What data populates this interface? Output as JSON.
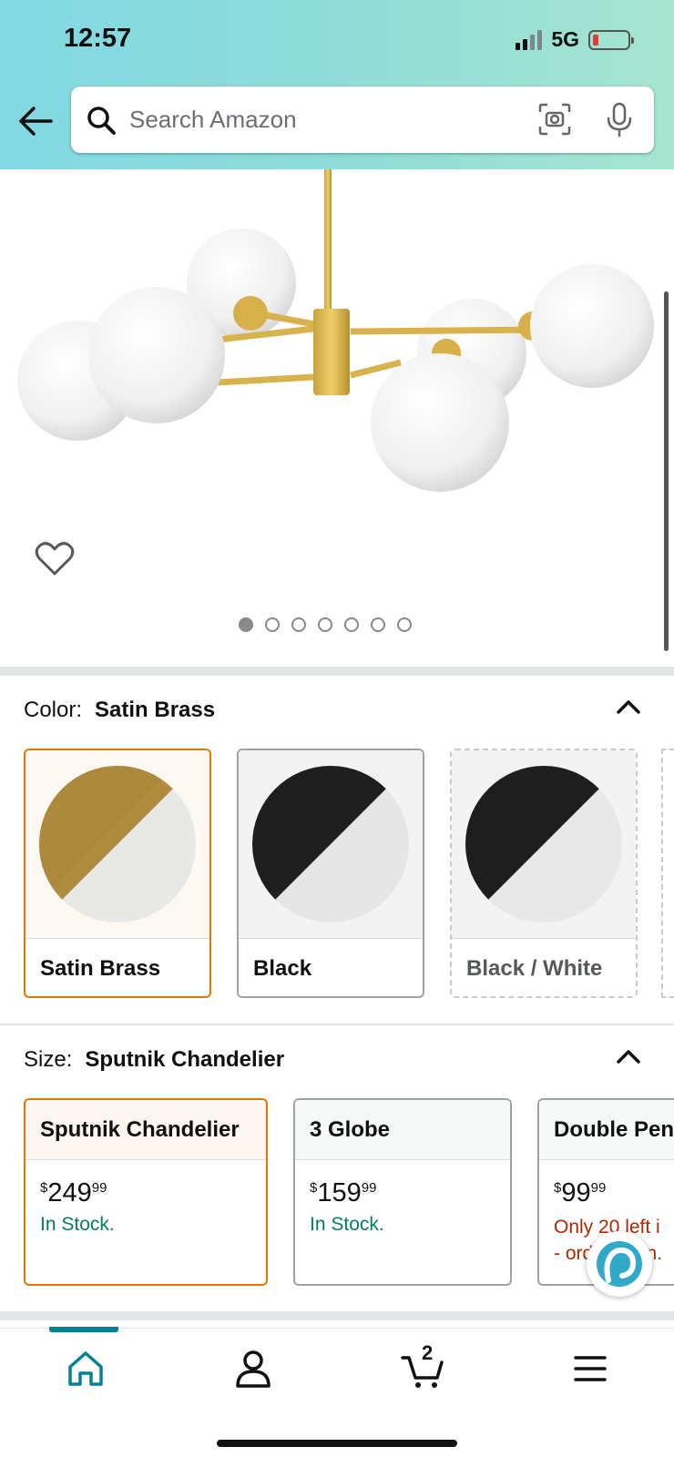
{
  "status_bar": {
    "time": "12:57",
    "network": "5G"
  },
  "search": {
    "placeholder": "Search Amazon"
  },
  "gallery": {
    "image_count": 7,
    "active_index": 0
  },
  "color": {
    "label": "Color:",
    "selected": "Satin Brass",
    "options": [
      {
        "name": "Satin Brass",
        "top_color": "#b08d3e",
        "state": "selected"
      },
      {
        "name": "Black",
        "top_color": "#1e1e1e",
        "state": "available"
      },
      {
        "name": "Black / White",
        "top_color": "#1e1e1e",
        "state": "unavailable"
      }
    ]
  },
  "size": {
    "label": "Size:",
    "selected": "Sputnik Chandelier",
    "options": [
      {
        "name": "Sputnik Chandelier",
        "currency": "$",
        "dollars": "249",
        "cents": "99",
        "stock": "In Stock.",
        "state": "selected"
      },
      {
        "name": "3 Globe",
        "currency": "$",
        "dollars": "159",
        "cents": "99",
        "stock": "In Stock.",
        "state": "available"
      },
      {
        "name": "Double Pen",
        "currency": "$",
        "dollars": "99",
        "cents": "99",
        "stock_line1": "Only 20 left i",
        "stock_line2": "- order soon.",
        "state": "available"
      }
    ]
  },
  "bottom_nav": {
    "items": [
      "home",
      "account",
      "cart",
      "menu"
    ],
    "active": "home",
    "cart_count": "2"
  },
  "colors": {
    "accent_teal": "#008296",
    "selected_orange": "#e77600",
    "in_stock_green": "#067d62",
    "low_stock_red": "#b12704"
  }
}
